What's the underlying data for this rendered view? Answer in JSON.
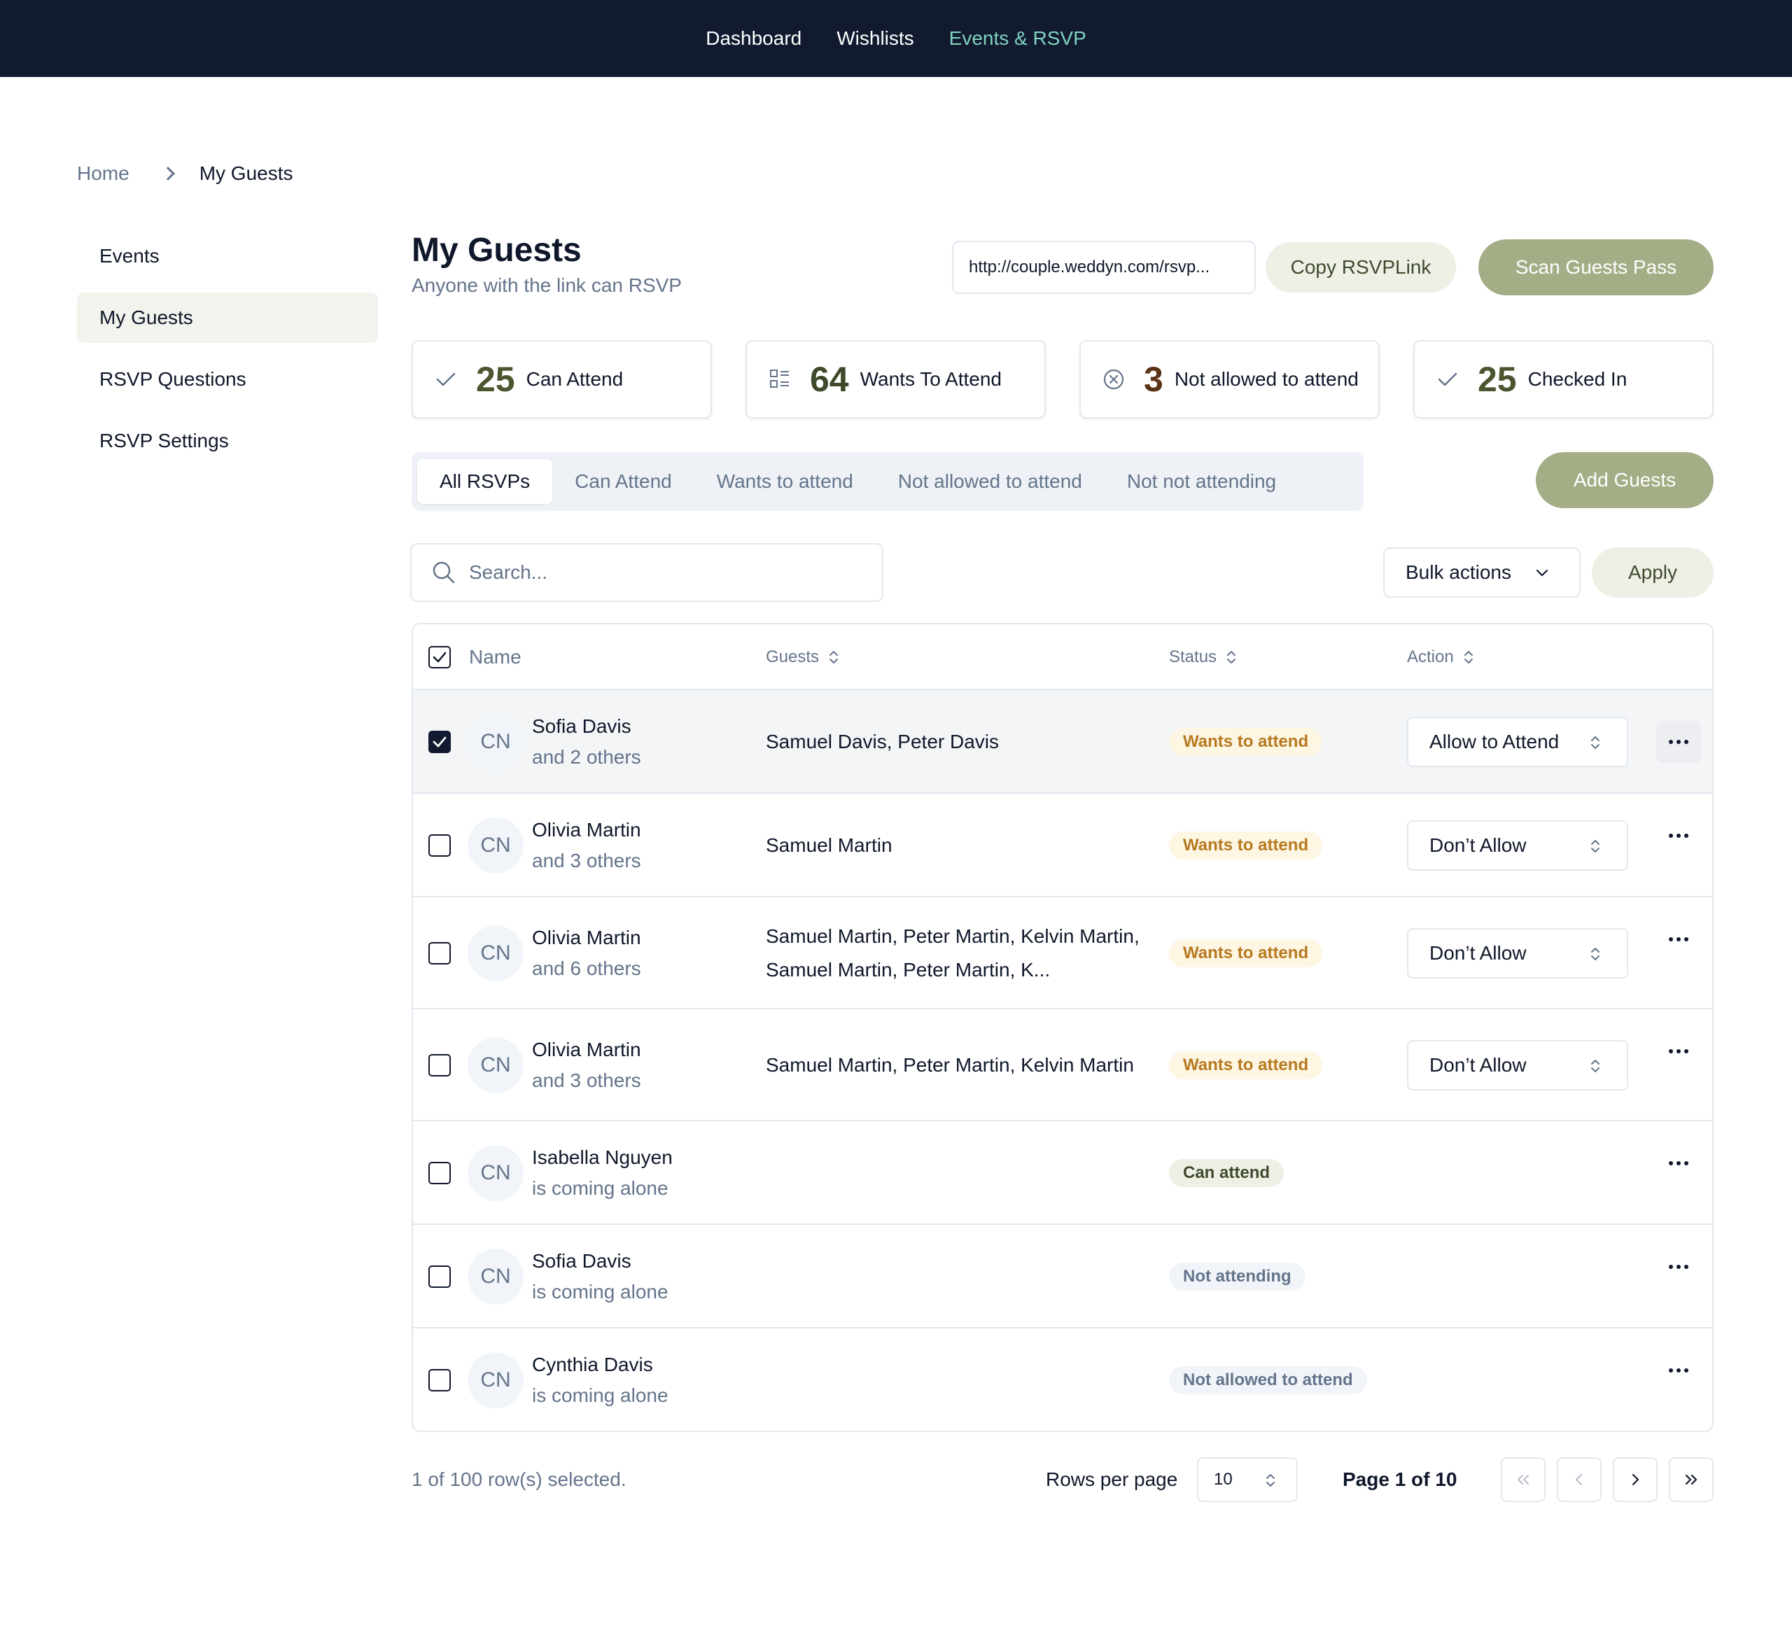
{
  "nav": {
    "items": [
      {
        "label": "Dashboard",
        "active": false
      },
      {
        "label": "Wishlists",
        "active": false
      },
      {
        "label": "Events & RSVP",
        "active": true
      }
    ]
  },
  "breadcrumb": {
    "home": "Home",
    "current": "My Guests"
  },
  "sidebar": {
    "items": [
      {
        "label": "Events",
        "active": false
      },
      {
        "label": "My Guests",
        "active": true
      },
      {
        "label": "RSVP Questions",
        "active": false
      },
      {
        "label": "RSVP Settings",
        "active": false
      }
    ]
  },
  "header": {
    "title": "My Guests",
    "subtitle": "Anyone with the link can RSVP",
    "rsvp_link": "http://couple.weddyn.com/rsvp...",
    "copy_label": "Copy RSVPLink",
    "scan_label": "Scan Guests Pass"
  },
  "stats": [
    {
      "icon": "check-icon",
      "value": "25",
      "label": "Can Attend",
      "color": "#4b5530"
    },
    {
      "icon": "list-icon",
      "value": "64",
      "label": "Wants To Attend",
      "color": "#3f4a2c"
    },
    {
      "icon": "x-circle-icon",
      "value": "3",
      "label": "Not allowed to attend",
      "color": "#5b3216"
    },
    {
      "icon": "check-icon",
      "value": "25",
      "label": "Checked In",
      "color": "#4b5530"
    }
  ],
  "tabs": [
    {
      "label": "All RSVPs",
      "active": true
    },
    {
      "label": "Can Attend",
      "active": false
    },
    {
      "label": "Wants to attend",
      "active": false
    },
    {
      "label": "Not allowed to attend",
      "active": false
    },
    {
      "label": "Not not attending",
      "active": false
    }
  ],
  "add_guests_label": "Add Guests",
  "search": {
    "placeholder": "Search..."
  },
  "bulk": {
    "label": "Bulk actions",
    "apply_label": "Apply"
  },
  "table": {
    "columns": {
      "name": "Name",
      "guests": "Guests",
      "status": "Status",
      "action": "Action"
    },
    "rows": [
      {
        "selected": true,
        "initials": "CN",
        "name": "Sofia Davis",
        "sub": "and 2 others",
        "guests": "Samuel Davis, Peter Davis",
        "status": "Wants to attend",
        "status_kind": "wants",
        "action": "Allow to Attend"
      },
      {
        "selected": false,
        "initials": "CN",
        "name": "Olivia Martin",
        "sub": "and 3 others",
        "guests": "Samuel Martin",
        "status": "Wants to attend",
        "status_kind": "wants",
        "action": "Don’t Allow"
      },
      {
        "selected": false,
        "initials": "CN",
        "name": "Olivia Martin",
        "sub": "and 6 others",
        "guests": "Samuel Martin, Peter Martin, Kelvin Martin, Samuel Martin, Peter Martin, K...",
        "status": "Wants to attend",
        "status_kind": "wants",
        "action": "Don’t Allow"
      },
      {
        "selected": false,
        "initials": "CN",
        "name": "Olivia Martin",
        "sub": "and 3 others",
        "guests": "Samuel Martin, Peter Martin, Kelvin Martin",
        "status": "Wants to attend",
        "status_kind": "wants",
        "action": "Don’t Allow"
      },
      {
        "selected": false,
        "initials": "CN",
        "name": "Isabella Nguyen",
        "sub": "is coming alone",
        "guests": "",
        "status": "Can attend",
        "status_kind": "can",
        "action": ""
      },
      {
        "selected": false,
        "initials": "CN",
        "name": "Sofia Davis",
        "sub": "is coming alone",
        "guests": "",
        "status": "Not attending",
        "status_kind": "not",
        "action": ""
      },
      {
        "selected": false,
        "initials": "CN",
        "name": "Cynthia Davis",
        "sub": "is coming alone",
        "guests": "",
        "status": "Not allowed to attend",
        "status_kind": "not",
        "action": ""
      }
    ]
  },
  "footer": {
    "selection_text": "1 of 100 row(s) selected.",
    "rows_per_page_label": "Rows per page",
    "rows_per_page": "10",
    "page_text": "Page 1 of 10"
  }
}
